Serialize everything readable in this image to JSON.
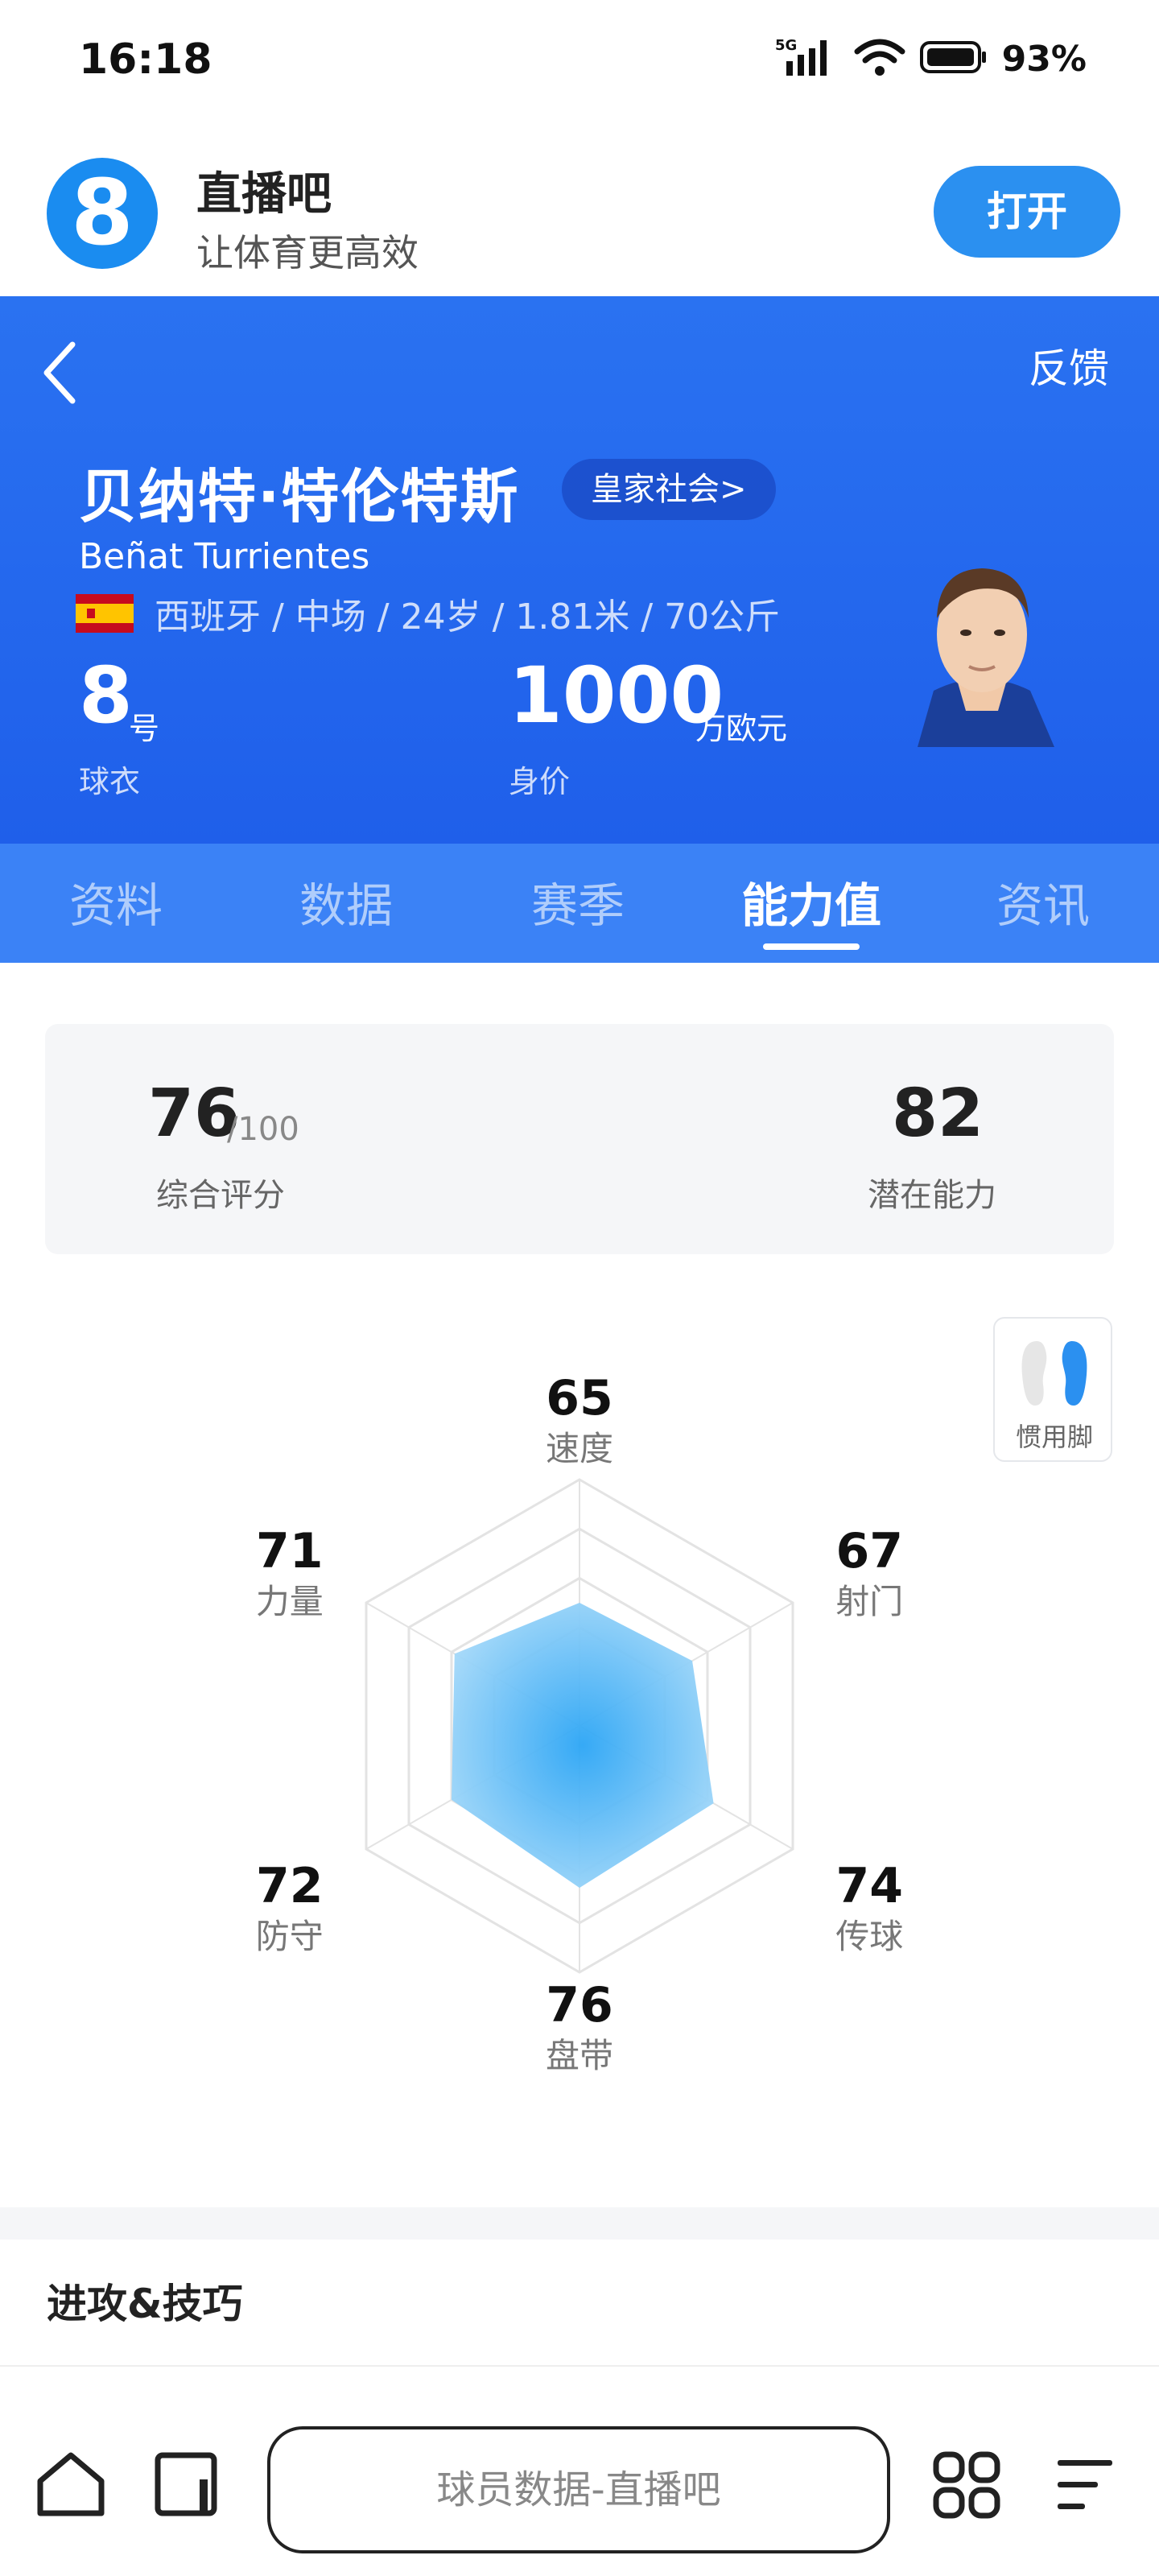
{
  "status_bar": {
    "time": "16:18",
    "network": "5G",
    "battery": "93%"
  },
  "promo": {
    "logo_text": "8",
    "app_name": "直播吧",
    "slogan": "让体育更高效",
    "open_button": "打开"
  },
  "hero": {
    "feedback": "反馈",
    "player_name": "贝纳特·特伦特斯",
    "club": "皇家社会>",
    "player_name_en": "Beñat Turrientes",
    "meta": "西班牙 / 中场 / 24岁 / 1.81米 / 70公斤",
    "jersey_number": "8",
    "jersey_unit": "号",
    "jersey_label": "球衣",
    "market_value": "1000",
    "market_value_unit": "万欧元",
    "market_value_label": "身价"
  },
  "tabs": [
    "资料",
    "数据",
    "赛季",
    "能力值",
    "资讯"
  ],
  "active_tab": "能力值",
  "rating": {
    "overall": "76",
    "overall_max": "/100",
    "overall_label": "综合评分",
    "potential": "82",
    "potential_label": "潜在能力"
  },
  "preferred_foot": {
    "label": "惯用脚",
    "value": "right"
  },
  "attributes": [
    {
      "name": "速度",
      "value": 65
    },
    {
      "name": "射门",
      "value": 67
    },
    {
      "name": "传球",
      "value": 74
    },
    {
      "name": "盘带",
      "value": 76
    },
    {
      "name": "防守",
      "value": 72
    },
    {
      "name": "力量",
      "value": 71
    }
  ],
  "section_title": "进攻&技巧",
  "bottom_bar": {
    "address_text": "球员数据-直播吧"
  },
  "colors": {
    "hero_blue": "#2a72f1",
    "tab_blue": "#3b82f6",
    "radar_fill": "#39a8f5"
  }
}
